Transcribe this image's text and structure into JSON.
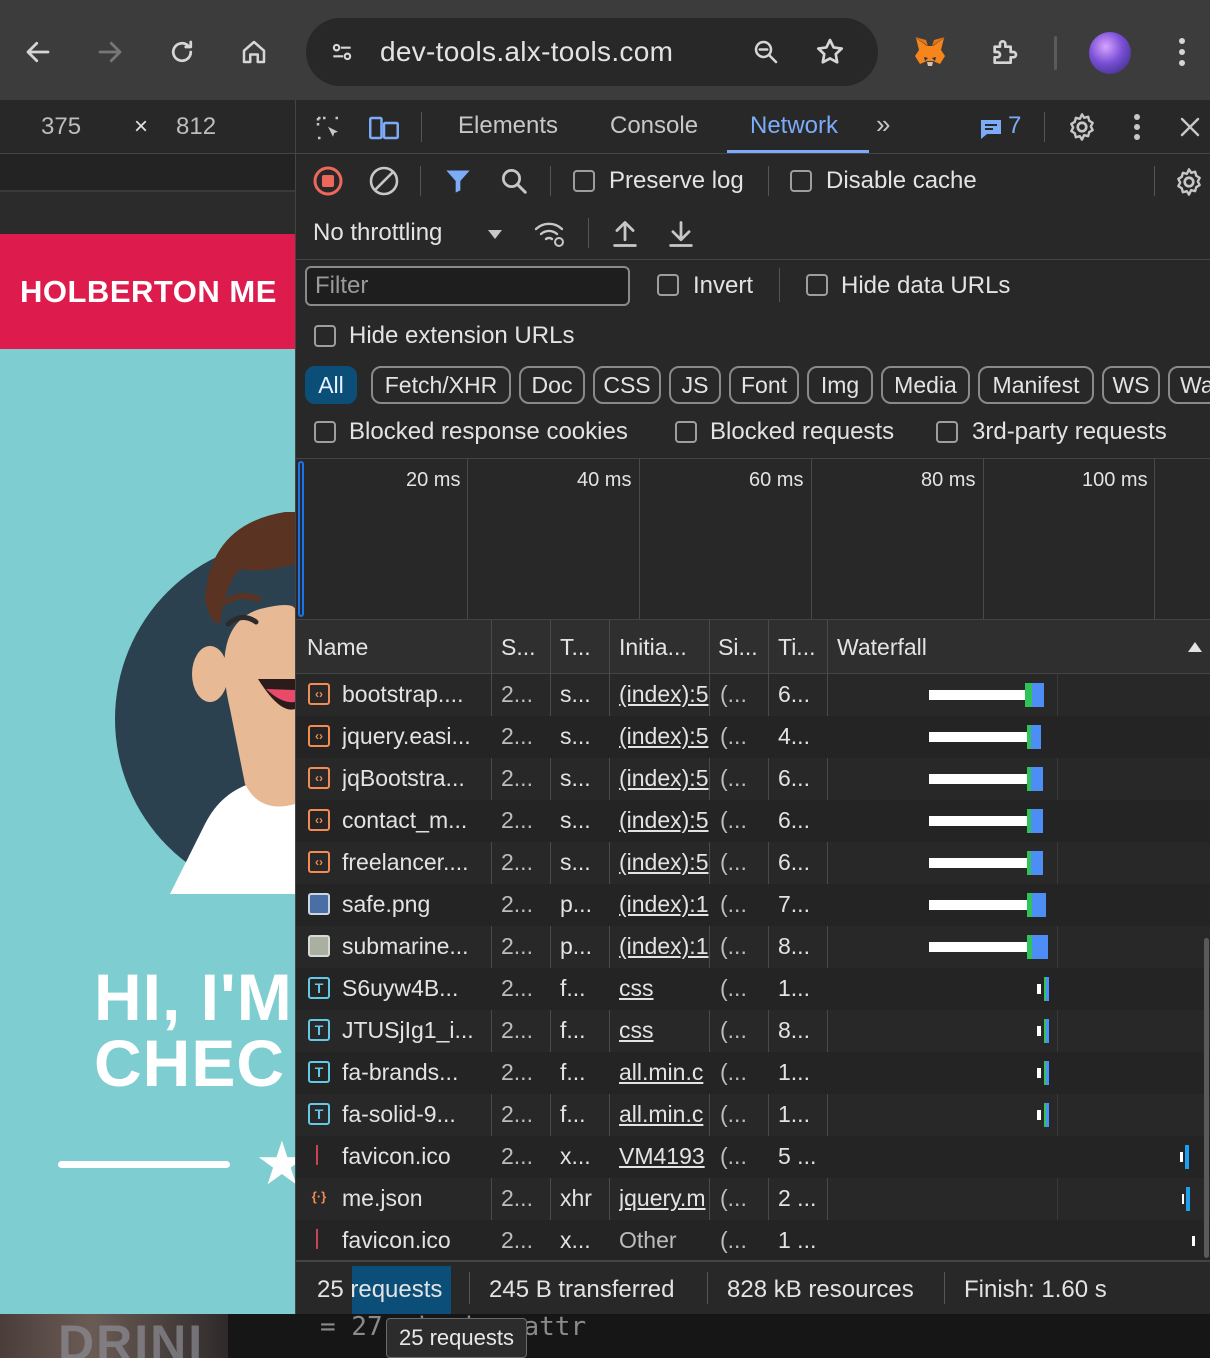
{
  "browser": {
    "url": "dev-tools.alx-tools.com",
    "icons": [
      "back-arrow-icon",
      "forward-arrow-icon",
      "reload-icon",
      "home-icon",
      "site-settings-icon",
      "zoom-icon",
      "bookmark-star-icon",
      "metamask-fox-icon",
      "extensions-puzzle-icon",
      "profile-avatar",
      "more-vert-icon"
    ]
  },
  "device_toolbar": {
    "width": "375",
    "times": "×",
    "height": "812"
  },
  "page": {
    "logo": "HOLBERTON ME",
    "hero_line1": "HI, I'M",
    "hero_line2": "CHEC",
    "accent_color": "#dd1b4c",
    "background_color": "#7ecdd0"
  },
  "devtools": {
    "tabs": [
      "Elements",
      "Console",
      "Network"
    ],
    "active_tab": "Network",
    "more_tabs": "»",
    "messages_count": "7",
    "toolbar": {
      "preserve_log": "Preserve log",
      "disable_cache": "Disable cache",
      "throttling": "No throttling"
    },
    "filter": {
      "placeholder": "Filter",
      "invert": "Invert",
      "hide_data_urls": "Hide data URLs",
      "hide_extension_urls": "Hide extension URLs",
      "blocked_response_cookies": "Blocked response cookies",
      "blocked_requests": "Blocked requests",
      "third_party_requests": "3rd-party requests"
    },
    "type_chips": [
      "All",
      "Fetch/XHR",
      "Doc",
      "CSS",
      "JS",
      "Font",
      "Img",
      "Media",
      "Manifest",
      "WS",
      "Wa"
    ],
    "active_chip": "All",
    "overview_labels": [
      "20 ms",
      "40 ms",
      "60 ms",
      "80 ms",
      "100 ms"
    ],
    "columns": [
      "Name",
      "S...",
      "T...",
      "Initia...",
      "Si...",
      "Ti...",
      "Waterfall"
    ],
    "rows": [
      {
        "name": "bootstrap....",
        "status": "2...",
        "type": "s...",
        "initiator": "(index):5",
        "size": "(...",
        "time": "6...",
        "icon": "script"
      },
      {
        "name": "jquery.easi...",
        "status": "2...",
        "type": "s...",
        "initiator": "(index):5",
        "size": "(...",
        "time": "4...",
        "icon": "script"
      },
      {
        "name": "jqBootstra...",
        "status": "2...",
        "type": "s...",
        "initiator": "(index):5",
        "size": "(...",
        "time": "6...",
        "icon": "script"
      },
      {
        "name": "contact_m...",
        "status": "2...",
        "type": "s...",
        "initiator": "(index):5",
        "size": "(...",
        "time": "6...",
        "icon": "script"
      },
      {
        "name": "freelancer....",
        "status": "2...",
        "type": "s...",
        "initiator": "(index):5",
        "size": "(...",
        "time": "6...",
        "icon": "script"
      },
      {
        "name": "safe.png",
        "status": "2...",
        "type": "p...",
        "initiator": "(index):1",
        "size": "(...",
        "time": "7...",
        "icon": "img"
      },
      {
        "name": "submarine...",
        "status": "2...",
        "type": "p...",
        "initiator": "(index):1",
        "size": "(...",
        "time": "8...",
        "icon": "img2"
      },
      {
        "name": "S6uyw4B...",
        "status": "2...",
        "type": "f...",
        "initiator": "css",
        "size": "(...",
        "time": "1...",
        "icon": "font"
      },
      {
        "name": "JTUSjIg1_i...",
        "status": "2...",
        "type": "f...",
        "initiator": "css",
        "size": "(...",
        "time": "8...",
        "icon": "font"
      },
      {
        "name": "fa-brands...",
        "status": "2...",
        "type": "f...",
        "initiator": "all.min.c",
        "size": "(...",
        "time": "1...",
        "icon": "font"
      },
      {
        "name": "fa-solid-9...",
        "status": "2...",
        "type": "f...",
        "initiator": "all.min.c",
        "size": "(...",
        "time": "1...",
        "icon": "font"
      },
      {
        "name": "favicon.ico",
        "status": "2...",
        "type": "x...",
        "initiator": "VM4193",
        "size": "(...",
        "time": "5 ...",
        "icon": "fav"
      },
      {
        "name": "me.json",
        "status": "2...",
        "type": "xhr",
        "initiator": "jquery.m",
        "size": "(...",
        "time": "2 ...",
        "icon": "json"
      },
      {
        "name": "favicon.ico",
        "status": "2...",
        "type": "x...",
        "initiator": "Other",
        "size": "(...",
        "time": "1 ...",
        "icon": "fav"
      }
    ],
    "status": {
      "requests_num": "25",
      "requests_word": " requests",
      "transferred": "245 B transferred",
      "resources": "828 kB resources",
      "finish": "Finish: 1.60 s"
    },
    "tooltip": "25 requests"
  },
  "under_page": {
    "drink": "DRINI",
    "code": "= 27-missing_attr"
  }
}
